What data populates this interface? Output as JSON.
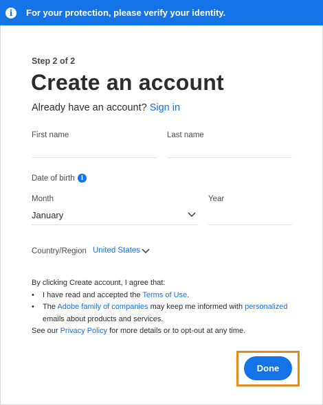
{
  "banner": {
    "message": "For your protection, please verify your identity."
  },
  "form": {
    "step": "Step 2 of 2",
    "title": "Create an account",
    "already_prefix": "Already have an account?",
    "sign_in": "Sign in",
    "first_name_label": "First name",
    "last_name_label": "Last name",
    "dob_label": "Date of birth",
    "month_label": "Month",
    "month_value": "January",
    "year_label": "Year",
    "country_label": "Country/Region",
    "country_value": "United States"
  },
  "legal": {
    "intro": "By clicking Create account, I agree that:",
    "b1_prefix": "I have read and accepted the",
    "terms_link": "Terms of Use",
    "b1_suffix": ".",
    "b2_prefix": "The",
    "adobe_link": "Adobe family of companies",
    "b2_mid": "may keep me informed with",
    "personalized_link": "personalized",
    "b2_line2": "emails about products and services.",
    "see_prefix": "See our",
    "privacy_link": "Privacy Policy",
    "see_suffix": "for more details or to opt-out at any time."
  },
  "actions": {
    "done_label": "Done"
  },
  "colors": {
    "accent": "#1473e6",
    "highlight": "#e38a1a"
  }
}
